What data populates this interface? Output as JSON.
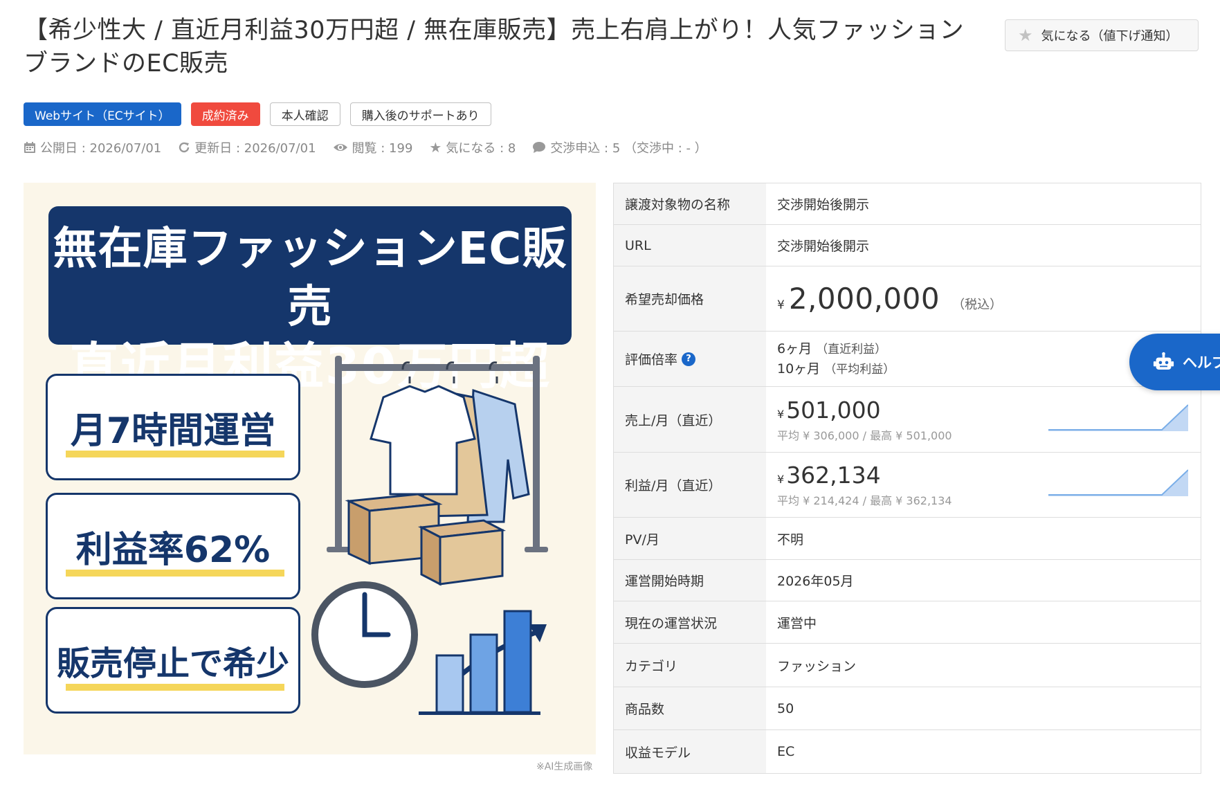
{
  "listing": {
    "title": "【希少性大 / 直近月利益30万円超 / 無在庫販売】売上右肩上がり！人気ファッションブランドのEC販売",
    "favorite_button": "気になる（値下げ通知）"
  },
  "tags": [
    {
      "label": "Webサイト（ECサイト）",
      "style": "blue"
    },
    {
      "label": "成約済み",
      "style": "red"
    },
    {
      "label": "本人確認",
      "style": "outline"
    },
    {
      "label": "購入後のサポートあり",
      "style": "outline"
    }
  ],
  "meta": {
    "published": "公開日 : 2026/07/01",
    "updated": "更新日 : 2026/07/01",
    "views": "閲覧 : 199",
    "favorites": "気になる : 8",
    "negotiations": "交渉申込 : 5 （交渉中 : - ）"
  },
  "hero": {
    "banner_line1": "無在庫ファッションEC販売",
    "banner_line2": "直近月利益30万円超",
    "card1": "月7時間運営",
    "card2": "利益率62%",
    "card3": "販売停止で希少",
    "caption": "※AI生成画像"
  },
  "details": {
    "name_label": "譲渡対象物の名称",
    "name_value": "交渉開始後開示",
    "url_label": "URL",
    "url_value": "交渉開始後開示",
    "price_label": "希望売却価格",
    "price_currency": "¥",
    "price_value": "2,000,000",
    "price_tax": "（税込）",
    "rate_label": "評価倍率",
    "rate_line1_num": "6ヶ月",
    "rate_line1_note": "（直近利益）",
    "rate_line2_num": "10ヶ月",
    "rate_line2_note": "（平均利益）",
    "sales_label": "売上/月（直近）",
    "sales_currency": "¥",
    "sales_value": "501,000",
    "sales_sub": "平均 ¥ 306,000 / 最高 ¥ 501,000",
    "profit_label": "利益/月（直近）",
    "profit_currency": "¥",
    "profit_value": "362,134",
    "profit_sub": "平均 ¥ 214,424 / 最高 ¥ 362,134",
    "pv_label": "PV/月",
    "pv_value": "不明",
    "start_label": "運営開始時期",
    "start_value": "2026年05月",
    "status_label": "現在の運営状況",
    "status_value": "運営中",
    "category_label": "カテゴリ",
    "category_value": "ファッション",
    "products_label": "商品数",
    "products_value": "50",
    "model_label": "収益モデル",
    "model_value": "EC"
  },
  "help_button": "ヘルプ",
  "colors": {
    "accent": "#1a67c9",
    "sold": "#f04a3e",
    "navy": "#15366b",
    "spark": "#a8c8f0"
  }
}
